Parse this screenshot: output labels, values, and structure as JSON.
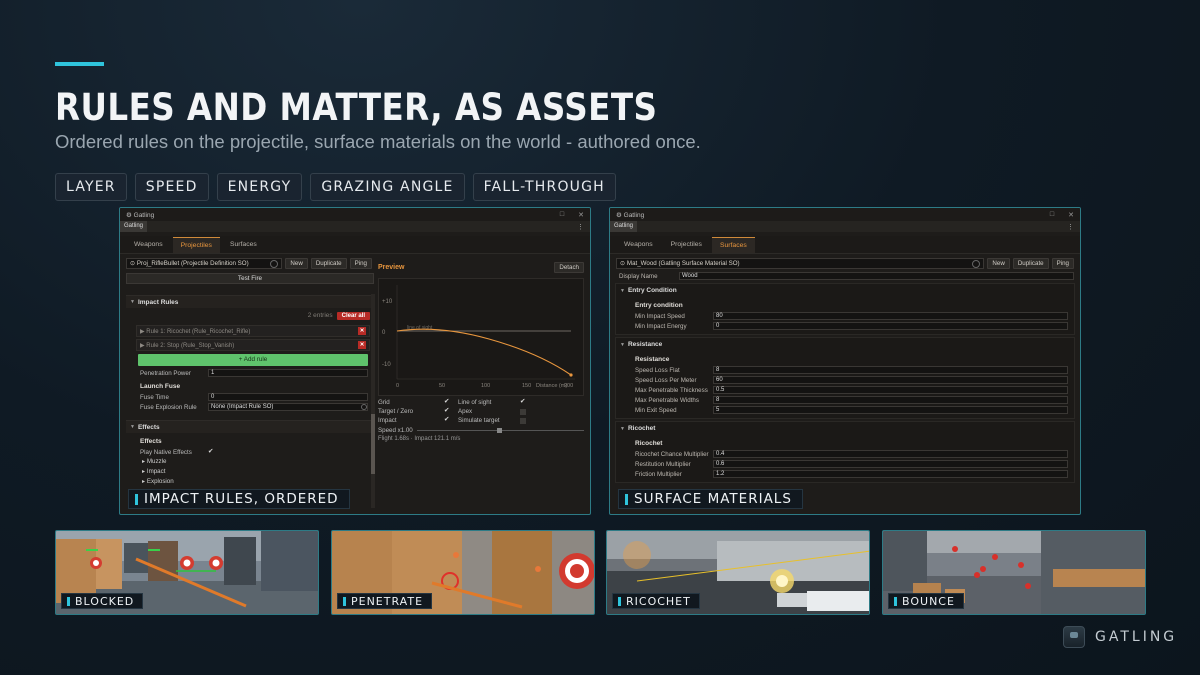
{
  "header": {
    "title": "RULES AND MATTER, AS ASSETS",
    "subtitle": "Ordered rules on the projectile, surface materials on the world - authored once."
  },
  "tags": [
    "LAYER",
    "SPEED",
    "ENERGY",
    "GRAZING ANGLE",
    "FALL-THROUGH"
  ],
  "left_panel": {
    "window_title": "Gatling",
    "dock_tab": "Gatling",
    "tabs": [
      "Weapons",
      "Projectiles",
      "Surfaces"
    ],
    "active_tab": "Projectiles",
    "asset": "Proj_RifleBullet (Projectile Definition SO)",
    "buttons": {
      "new": "New",
      "duplicate": "Duplicate",
      "ping": "Ping",
      "test_fire": "Test Fire",
      "clear_all": "Clear all",
      "add_rule": "+ Add rule",
      "detach": "Detach"
    },
    "impact_rules": {
      "header": "Impact Rules",
      "entries": "2 entries",
      "rules": [
        "Rule 1: Ricochet (Rule_Ricochet_Rifle)",
        "Rule 2: Stop (Rule_Stop_Vanish)"
      ]
    },
    "penetration_power": {
      "label": "Penetration Power",
      "value": "1"
    },
    "launch_fuse": {
      "header": "Launch Fuse",
      "fuse_time": {
        "label": "Fuse Time",
        "value": "0"
      },
      "fuse_explosion_rule": {
        "label": "Fuse Explosion Rule",
        "value": "None (Impact Rule SO)"
      }
    },
    "effects": {
      "section": "Effects",
      "header": "Effects",
      "play_native": "Play Native Effects",
      "foldouts": [
        "Muzzle",
        "Impact",
        "Explosion"
      ]
    },
    "preview": {
      "title": "Preview",
      "y_ticks": [
        "+10",
        "0",
        "-10"
      ],
      "x_ticks": [
        "0",
        "50",
        "100",
        "150",
        "200"
      ],
      "x_axis_label": "Distance (m)",
      "line_label": "line of sight",
      "options": [
        {
          "label": "Grid",
          "checked": true
        },
        {
          "label": "Line of sight",
          "checked": true
        },
        {
          "label": "Target / Zero",
          "checked": true
        },
        {
          "label": "Apex",
          "checked": false
        },
        {
          "label": "Impact",
          "checked": true
        },
        {
          "label": "Simulate target",
          "checked": false
        }
      ],
      "speed": "Speed x1.00",
      "flight_info": "Flight 1.68s · Impact 121.1 m/s"
    },
    "caption": "IMPACT RULES, ORDERED"
  },
  "right_panel": {
    "window_title": "Gatling",
    "dock_tab": "Gatling",
    "tabs": [
      "Weapons",
      "Projectiles",
      "Surfaces"
    ],
    "active_tab": "Surfaces",
    "asset": "Mat_Wood (Gatling Surface Material SO)",
    "buttons": {
      "new": "New",
      "duplicate": "Duplicate",
      "ping": "Ping"
    },
    "display_name": {
      "label": "Display Name",
      "value": "Wood"
    },
    "entry_condition": {
      "header": "Entry Condition",
      "sub": "Entry condition",
      "fields": [
        {
          "label": "Min Impact Speed",
          "value": "80"
        },
        {
          "label": "Min Impact Energy",
          "value": "0"
        }
      ]
    },
    "resistance": {
      "header": "Resistance",
      "sub": "Resistance",
      "fields": [
        {
          "label": "Speed Loss Flat",
          "value": "8"
        },
        {
          "label": "Speed Loss Per Meter",
          "value": "60"
        },
        {
          "label": "Max Penetrable Thickness",
          "value": "0.5"
        },
        {
          "label": "Max Penetrable Widths",
          "value": "8"
        },
        {
          "label": "Min Exit Speed",
          "value": "5"
        }
      ]
    },
    "ricochet": {
      "header": "Ricochet",
      "sub": "Ricochet",
      "fields": [
        {
          "label": "Ricochet Chance Multiplier",
          "value": "0.4"
        },
        {
          "label": "Restitution Multiplier",
          "value": "0.6"
        },
        {
          "label": "Friction Multiplier",
          "value": "1.2"
        }
      ]
    },
    "caption": "SURFACE MATERIALS"
  },
  "thumbnails": [
    "BLOCKED",
    "PENETRATE",
    "RICOCHET",
    "BOUNCE"
  ],
  "brand": "GATLING",
  "colors": {
    "accent": "#2fc4dc",
    "orange": "#e8963e",
    "danger": "#b82b26",
    "green": "#5fc36c"
  }
}
